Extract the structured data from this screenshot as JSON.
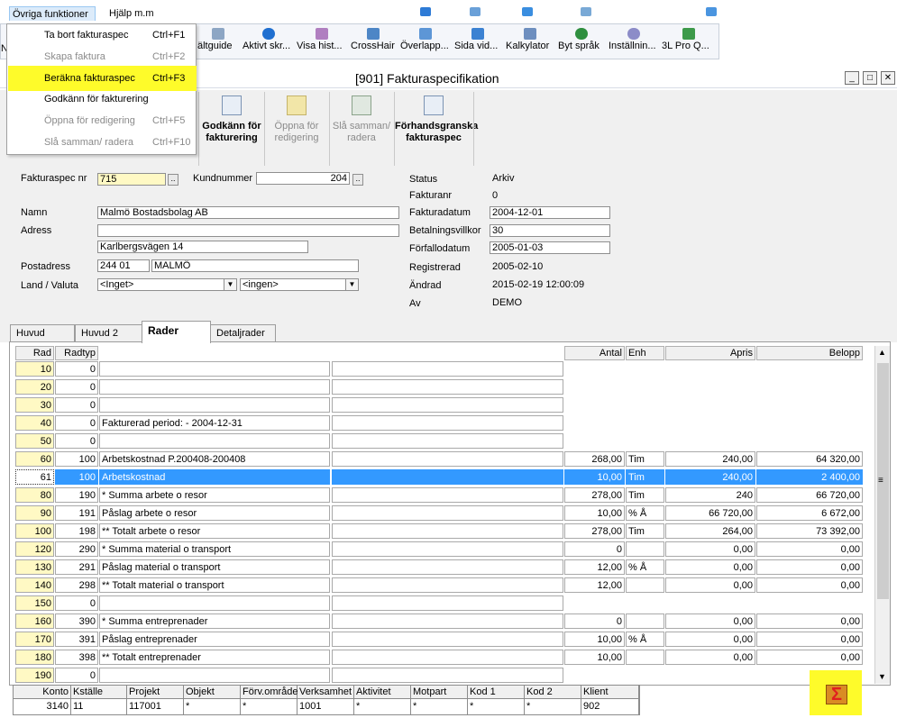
{
  "menubar": {
    "items": [
      "Övriga funktioner",
      "Hjälp m.m"
    ]
  },
  "dropdown": {
    "items": [
      {
        "label": "Ta bort fakturaspec",
        "shortcut": "Ctrl+F1",
        "enabled": true
      },
      {
        "label": "Skapa faktura",
        "shortcut": "Ctrl+F2",
        "enabled": false
      },
      {
        "label": "Beräkna fakturaspec",
        "shortcut": "Ctrl+F3",
        "enabled": true,
        "highlighted": true
      },
      {
        "label": "Godkänn för fakturering",
        "shortcut": "",
        "enabled": true
      },
      {
        "label": "Öppna för redigering",
        "shortcut": "Ctrl+F5",
        "enabled": false
      },
      {
        "label": "Slå samman/ radera",
        "shortcut": "Ctrl+F10",
        "enabled": false
      }
    ]
  },
  "toolbar": {
    "partial_left": "N",
    "buttons": [
      "ältguide",
      "Aktivt skr...",
      "Visa hist...",
      "CrossHair",
      "Överlapp...",
      "Sida vid...",
      "Kalkylator",
      "Byt språk",
      "Inställnin...",
      "3L Pro Q..."
    ]
  },
  "window": {
    "title": "[901]  Fakturaspecifikation",
    "buttons": [
      "_",
      "□",
      "✕"
    ]
  },
  "actions": [
    {
      "label": "Godkänn för fakturering",
      "enabled": true
    },
    {
      "label": "Öppna för redigering",
      "enabled": false
    },
    {
      "label": "Slå samman/ radera",
      "enabled": false
    },
    {
      "label": "Förhandsgranska fakturaspec",
      "enabled": true
    }
  ],
  "form": {
    "fakturaspec_label": "Fakturaspec nr",
    "fakturaspec_value": "715",
    "kundnummer_label": "Kundnummer",
    "kundnummer_value": "204",
    "namn_label": "Namn",
    "namn_value": "Malmö Bostadsbolag AB",
    "adress_label": "Adress",
    "adress_line1": "",
    "adress_line2": "Karlbergsvägen 14",
    "postadress_label": "Postadress",
    "postnr": "244 01",
    "ort": "MALMÖ",
    "land_label": "Land / Valuta",
    "land_value": "<Inget>",
    "valuta_value": "<ingen>",
    "status_label": "Status",
    "status_value": "Arkiv",
    "fakturanr_label": "Fakturanr",
    "fakturanr_value": "0",
    "fakturadatum_label": "Fakturadatum",
    "fakturadatum_value": "2004-12-01",
    "betalningsvillkor_label": "Betalningsvillkor",
    "betalningsvillkor_value": "30",
    "forfallodatum_label": "Förfallodatum",
    "forfallodatum_value": "2005-01-03",
    "registrerad_label": "Registrerad",
    "registrerad_value": "2005-02-10",
    "andrad_label": "Ändrad",
    "andrad_value": "2015-02-19 12:00:09",
    "av_label": "Av",
    "av_value": "DEMO"
  },
  "tabs": [
    "Huvud",
    "Huvud 2",
    "Rader",
    "Detaljrader"
  ],
  "grid": {
    "headers": {
      "rad": "Rad",
      "radtyp": "Radtyp",
      "antal": "Antal",
      "enh": "Enh",
      "apris": "Apris",
      "belopp": "Belopp"
    },
    "rows": [
      {
        "rad": "10",
        "radtyp": "0",
        "text": "",
        "antal": "",
        "enh": "",
        "apris": "",
        "belopp": "",
        "wide": false
      },
      {
        "rad": "20",
        "radtyp": "0",
        "text": "",
        "antal": "",
        "enh": "",
        "apris": "",
        "belopp": "",
        "wide": false
      },
      {
        "rad": "30",
        "radtyp": "0",
        "text": "",
        "antal": "",
        "enh": "",
        "apris": "",
        "belopp": "",
        "wide": false
      },
      {
        "rad": "40",
        "radtyp": "0",
        "text": "Fakturerad period:  - 2004-12-31",
        "antal": "",
        "enh": "",
        "apris": "",
        "belopp": "",
        "wide": false
      },
      {
        "rad": "50",
        "radtyp": "0",
        "text": "",
        "antal": "",
        "enh": "",
        "apris": "",
        "belopp": "",
        "wide": false
      },
      {
        "rad": "60",
        "radtyp": "100",
        "text": "Arbetskostnad P.200408-200408",
        "antal": "268,00",
        "enh": "Tim",
        "apris": "240,00",
        "belopp": "64 320,00",
        "wide": true
      },
      {
        "rad": "61",
        "radtyp": "100",
        "text": "Arbetskostnad",
        "antal": "10,00",
        "enh": "Tim",
        "apris": "240,00",
        "belopp": "2 400,00",
        "wide": true,
        "selected": true
      },
      {
        "rad": "80",
        "radtyp": "190",
        "text": "* Summa arbete o resor",
        "antal": "278,00",
        "enh": "Tim",
        "apris": "240",
        "belopp": "66 720,00",
        "wide": true
      },
      {
        "rad": "90",
        "radtyp": "191",
        "text": "Påslag arbete o resor",
        "antal": "10,00",
        "enh": "% Å",
        "apris": "66 720,00",
        "belopp": "6 672,00",
        "wide": true
      },
      {
        "rad": "100",
        "radtyp": "198",
        "text": "** Totalt arbete o resor",
        "antal": "278,00",
        "enh": "Tim",
        "apris": "264,00",
        "belopp": "73 392,00",
        "wide": true
      },
      {
        "rad": "120",
        "radtyp": "290",
        "text": "* Summa material o transport",
        "antal": "0",
        "enh": "",
        "apris": "0,00",
        "belopp": "0,00",
        "wide": true
      },
      {
        "rad": "130",
        "radtyp": "291",
        "text": "Påslag material o transport",
        "antal": "12,00",
        "enh": "% Å",
        "apris": "0,00",
        "belopp": "0,00",
        "wide": true
      },
      {
        "rad": "140",
        "radtyp": "298",
        "text": "** Totalt material o transport",
        "antal": "12,00",
        "enh": "",
        "apris": "0,00",
        "belopp": "0,00",
        "wide": true
      },
      {
        "rad": "150",
        "radtyp": "0",
        "text": "",
        "antal": "",
        "enh": "",
        "apris": "",
        "belopp": "",
        "wide": false
      },
      {
        "rad": "160",
        "radtyp": "390",
        "text": "* Summa entreprenader",
        "antal": "0",
        "enh": "",
        "apris": "0,00",
        "belopp": "0,00",
        "wide": true
      },
      {
        "rad": "170",
        "radtyp": "391",
        "text": "Påslag entreprenader",
        "antal": "10,00",
        "enh": "% Å",
        "apris": "0,00",
        "belopp": "0,00",
        "wide": true
      },
      {
        "rad": "180",
        "radtyp": "398",
        "text": "** Totalt entreprenader",
        "antal": "10,00",
        "enh": "",
        "apris": "0,00",
        "belopp": "0,00",
        "wide": true
      },
      {
        "rad": "190",
        "radtyp": "0",
        "text": "",
        "antal": "",
        "enh": "",
        "apris": "",
        "belopp": "",
        "wide": false
      }
    ],
    "scroll_grip": "≡"
  },
  "account": {
    "headers": [
      "Konto",
      "Kställe",
      "Projekt",
      "Objekt",
      "Förv.område",
      "Verksamhet",
      "Aktivitet",
      "Motpart",
      "Kod 1",
      "Kod 2",
      "Klient"
    ],
    "values": [
      "3140",
      "11",
      "117001",
      "*",
      "*",
      "1001",
      "*",
      "*",
      "*",
      "*",
      "902"
    ]
  },
  "sum_button": {
    "glyph": "Σ"
  },
  "colors": {
    "highlight": "#fefb2a",
    "selection": "#3399ff",
    "yellow_cell": "#fff9c4"
  }
}
